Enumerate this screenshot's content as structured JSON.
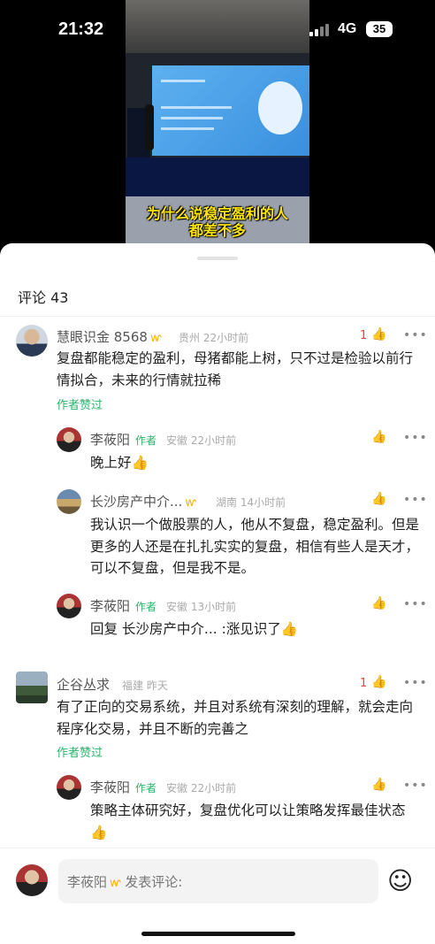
{
  "status": {
    "time": "21:32",
    "network": "4G",
    "battery": "35"
  },
  "video": {
    "caption_line1": "为什么说稳定盈利的人",
    "caption_line2": "都差不多"
  },
  "comments_header": "评论 43",
  "comments": [
    {
      "name": "慧眼识金 8568",
      "location": "贵州",
      "time": "22小时前",
      "likes": "1",
      "text": "复盘都能稳定的盈利，母猪都能上树，只不过是检验以前行情拟合，未来的行情就拉稀",
      "author_liked": "作者赞过",
      "replies": [
        {
          "name": "李莜阳",
          "tag": "作者",
          "location": "安徽",
          "time": "22小时前",
          "text": "晚上好"
        },
        {
          "name": "长沙房产中介...",
          "location": "湖南",
          "time": "14小时前",
          "text": "我认识一个做股票的人，他从不复盘，稳定盈利。但是更多的人还是在扎扎实实的复盘，相信有些人是天才，可以不复盘，但是我不是。"
        },
        {
          "name": "李莜阳",
          "tag": "作者",
          "location": "安徽",
          "time": "13小时前",
          "text": "回复 长沙房产中介... :涨见识了"
        }
      ]
    },
    {
      "name": "企谷丛求",
      "location": "福建",
      "time": "昨天",
      "likes": "1",
      "text": "有了正向的交易系统，并且对系统有深刻的理解，就会走向程序化交易，并且不断的完善之",
      "author_liked": "作者赞过",
      "replies": [
        {
          "name": "李莜阳",
          "tag": "作者",
          "location": "安徽",
          "time": "22小时前",
          "text": "策略主体研究好，复盘优化可以让策略发挥最佳状态"
        }
      ]
    }
  ],
  "input": {
    "user": "李莜阳",
    "placeholder": "发表评论:"
  },
  "icons": {
    "badge": "crown-badge-icon",
    "thumb": "thumb-up-icon",
    "more": "more-icon",
    "emoji": "smile-emoji-icon"
  }
}
